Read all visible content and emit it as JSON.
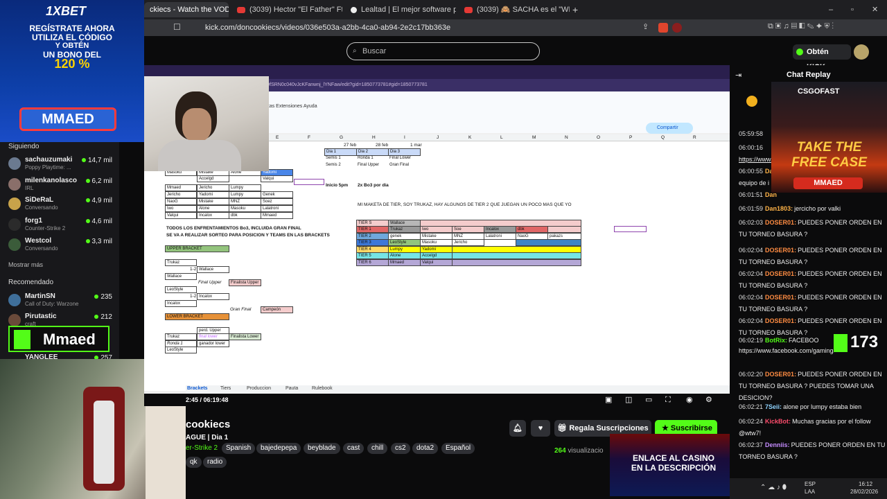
{
  "browser": {
    "tabs": [
      {
        "label": "ckiecs - Watch the VOD o"
      },
      {
        "label": "(3039) Hector \"El Father\" Ft. Wise - S"
      },
      {
        "label": "Lealtad | El mejor software para pote"
      },
      {
        "label": "(3039) 🙈 SACHA es el \"WESTCOL d"
      }
    ],
    "url": "kick.com/doncookiecs/videos/036e503a-a2bb-4ca0-ab94-2e2c17bb363e"
  },
  "header": {
    "search_placeholder": "Buscar",
    "kicks_button": "Obtén KICKs"
  },
  "ad_left": {
    "brand": "1XBET",
    "line1": "REGÍSTRATE AHORA",
    "line2": "UTILIZA EL CÓDIGO",
    "line3": "Y OBTÉN",
    "line4": "UN BONO DEL",
    "line5": "120 %",
    "code": "MMAED"
  },
  "sidebar": {
    "following_title": "Siguiendo",
    "following": [
      {
        "name": "sachauzumaki",
        "sub": "Poppy Playtime: ...",
        "viewers": "14,7 mil",
        "color": "#6b7a90"
      },
      {
        "name": "milenkanolasco",
        "sub": "IRL",
        "viewers": "6,2 mil",
        "color": "#8a6f6a"
      },
      {
        "name": "SiDeRaL",
        "sub": "Conversando",
        "viewers": "4,9 mil",
        "color": "#c8a34a"
      },
      {
        "name": "forg1",
        "sub": "Counter-Strike 2",
        "viewers": "4,6 mil",
        "color": "#2b2b2b"
      },
      {
        "name": "Westcol",
        "sub": "Conversando",
        "viewers": "3,3 mil",
        "color": "#3b5c3a"
      }
    ],
    "show_more": "Mostrar más",
    "recommended_title": "Recomendado",
    "recommended": [
      {
        "name": "MartinSN",
        "sub": "Call of Duty: Warzone",
        "viewers": "235",
        "color": "#3f6f9a"
      },
      {
        "name": "Pirutastic",
        "sub": "craft",
        "viewers": "212",
        "color": "#6a4a3a"
      },
      {
        "name": "YANGLEE",
        "sub": "",
        "viewers": "257",
        "color": "#4a4a4a"
      }
    ]
  },
  "overlay_left": {
    "label": "Mmaed"
  },
  "video": {
    "sheets_menu": "ntas   Extensiones   Ayuda",
    "share": "Compartir",
    "time": "2:45 / 06:19:48",
    "sheet_tabs": [
      "Brackets",
      "Tiers",
      "Produccion",
      "Pauta",
      "Rulebook"
    ],
    "columns": [
      "E",
      "F",
      "G",
      "H",
      "I",
      "J",
      "K",
      "L",
      "M",
      "N",
      "O",
      "P",
      "Q",
      "R"
    ],
    "dates": [
      "27 feb",
      "28 feb",
      "1 mar"
    ],
    "days": [
      "Dia 1",
      "Dia 2",
      "Dia 3"
    ],
    "day_rows": [
      [
        "Semis 1",
        "Ronda 1",
        "Final Lower"
      ],
      [
        "Semis 2",
        "Final Upper",
        "Gran Final"
      ]
    ],
    "inicio": "Inicio 5pm",
    "bo3": "2x Bo3 por dia",
    "maqueta": "MI MAKETA DE TIER, SOY TRUKAZ, HAY ALGUNOS DE TIER 2 QUE JUEGAN UN POCO MAS QUE YO",
    "note1": "TODOS LOS ENFRENTAMIENTOS Bo3, INCLUIDA GRAN FINAL",
    "note2": "SE VA A REALIZAR SORTEO PARA POSICION Y TEAMS EN LAS BRACKETS",
    "upper": "UPPER BRACKET",
    "lower": "LOWER BRACKET",
    "tiers": [
      {
        "tier": "TIER S",
        "players": [
          "Wallace",
          "",
          "",
          "",
          "",
          ""
        ]
      },
      {
        "tier": "TIER 1",
        "players": [
          "Trukaz",
          "Iwo",
          "Soe",
          "Incalox",
          "dbk",
          ""
        ]
      },
      {
        "tier": "TIER 2",
        "players": [
          "genek",
          "Mistake",
          "MNZ",
          "Lalatroni",
          "NaoG",
          "pakazs"
        ]
      },
      {
        "tier": "TIER 3",
        "players": [
          "LeoStyle",
          "Masoku",
          "Jericho",
          "",
          "",
          ""
        ]
      },
      {
        "tier": "TIER 4",
        "players": [
          "Lumpy",
          "Yadomi",
          "",
          "",
          "",
          ""
        ]
      },
      {
        "tier": "TIER 5",
        "players": [
          "Alone",
          "Accelgd",
          "",
          "",
          "",
          ""
        ]
      },
      {
        "tier": "TIER 6",
        "players": [
          "Mmaed",
          "Valqui",
          "",
          "",
          "",
          ""
        ]
      }
    ],
    "teams_top": [
      [
        "Masoku",
        "Mistake",
        "Alone",
        "Yadomi"
      ],
      [
        "",
        "Accelgd",
        "",
        "Valqui"
      ]
    ],
    "teams": [
      [
        "Mmaed",
        "Jericho",
        "Lumpy",
        ""
      ],
      [
        "Jericho",
        "Yadomi",
        "Lumpy",
        "Genek"
      ],
      [
        "NaoG",
        "Mistake",
        "MNZ",
        "Soez"
      ],
      [
        "Iwo",
        "Alone",
        "Masoku",
        "Lalatroni"
      ],
      [
        "Valqui",
        "Incalox",
        "dbk",
        "Mmaed"
      ]
    ],
    "bracket": [
      "Trukaz",
      "Wallace",
      "Wallace",
      "LeoStyle",
      "Incalox"
    ],
    "bracket_labels": {
      "vs1": "1-2",
      "vs2": "1-2",
      "final_upper": "Final Upper",
      "finalista_upper": "Finalista Upper",
      "gran_final": "Gran Final",
      "campeon": "Campeón",
      "perd_upper": "perd. Upper",
      "final_lower": "final lower",
      "finalista_lower": "Finalista Lower",
      "ronda1": "Ronda 1",
      "ganador_lower": "ganador lower",
      "trukaz": "Trukaz",
      "leostyle": "LeoStyle"
    }
  },
  "stream": {
    "channel": "cookiecs",
    "title": "AGUE | Dia 1",
    "category": "er-Strike 2",
    "tags": [
      "Spanish",
      "bajedepepa",
      "beyblade",
      "cast",
      "chill",
      "cs2",
      "dota2",
      "Español",
      "qk",
      "radio"
    ],
    "gift_button": "Regala Suscripciones",
    "subscribe_button": "Suscribirse",
    "views_count": "264",
    "views_label": "visualizacio"
  },
  "ad_casino": {
    "line1": "ENLACE AL CASINO",
    "line2": "EN LA DESCRIPCIÓN"
  },
  "chat": {
    "title": "Chat Replay",
    "messages": [
      {
        "ts": "05:59:58",
        "user": "",
        "text": "",
        "color": "#ff5a5a"
      },
      {
        "ts": "06:00:16",
        "user": "",
        "text": "https://www.",
        "color": "#5ab0ff",
        "link": true
      },
      {
        "ts": "06:00:55",
        "user": "Da",
        "text": "equipo de i",
        "color": "#ffb347"
      },
      {
        "ts": "06:01:51",
        "user": "Dan",
        "text": "",
        "color": "#ffb347"
      },
      {
        "ts": "06:01:59",
        "user": "Dan1803:",
        "text": "jercicho por valki",
        "color": "#ffb347"
      },
      {
        "ts": "06:02:03",
        "user": "DOSER01:",
        "text": "PUEDES PONER ORDEN EN TU TORNEO BASURA ?",
        "color": "#ff8c42"
      },
      {
        "ts": "06:02:04",
        "user": "DOSER01:",
        "text": "PUEDES PONER ORDEN EN TU TORNEO BASURA ?",
        "color": "#ff8c42"
      },
      {
        "ts": "06:02:04",
        "user": "DOSER01:",
        "text": "PUEDES PONER ORDEN EN TU TORNEO BASURA ?",
        "color": "#ff8c42"
      },
      {
        "ts": "06:02:04",
        "user": "DOSER01:",
        "text": "PUEDES PONER ORDEN EN TU TORNEO BASURA ?",
        "color": "#ff8c42"
      },
      {
        "ts": "06:02:04",
        "user": "DOSER01:",
        "text": "PUEDES PONER ORDEN EN TU TORNEO BASURA ?",
        "color": "#ff8c42"
      },
      {
        "ts": "06:02:19",
        "user": "BotRix:",
        "text": "FACEBOO",
        "color": "#53fc18"
      },
      {
        "ts": "",
        "user": "",
        "text": "https://www.facebook.com/gaming/DonCookieC S",
        "color": "#5ab0ff",
        "link": true
      },
      {
        "ts": "06:02:20",
        "user": "DOSER01:",
        "text": "PUEDES PONER ORDEN EN TU TORNEO BASURA ? PUEDES TOMAR UNA DESICION?",
        "color": "#ff8c42"
      },
      {
        "ts": "06:02:21",
        "user": "7Seii:",
        "text": "alone por lumpy estaba bien",
        "color": "#8fd3ff"
      },
      {
        "ts": "06:02:24",
        "user": "KickBot:",
        "text": "Muchas gracias por el follow @wtw7!",
        "color": "#ff4d6d"
      },
      {
        "ts": "06:02:37",
        "user": "Denniis:",
        "text": "PUEDES PONER ORDEN EN TU TORNEO BASURA ?",
        "color": "#c58cff"
      }
    ]
  },
  "ad_csgo": {
    "logo": "CSGOFAST",
    "big1": "TAKE THE",
    "big2": "FREE CASE",
    "code": "MMAED"
  },
  "overlay_right": {
    "count": "173"
  },
  "taskbar": {
    "lang1": "ESP",
    "lang2": "LAA",
    "time": "16:12",
    "date": "28/02/2026"
  }
}
